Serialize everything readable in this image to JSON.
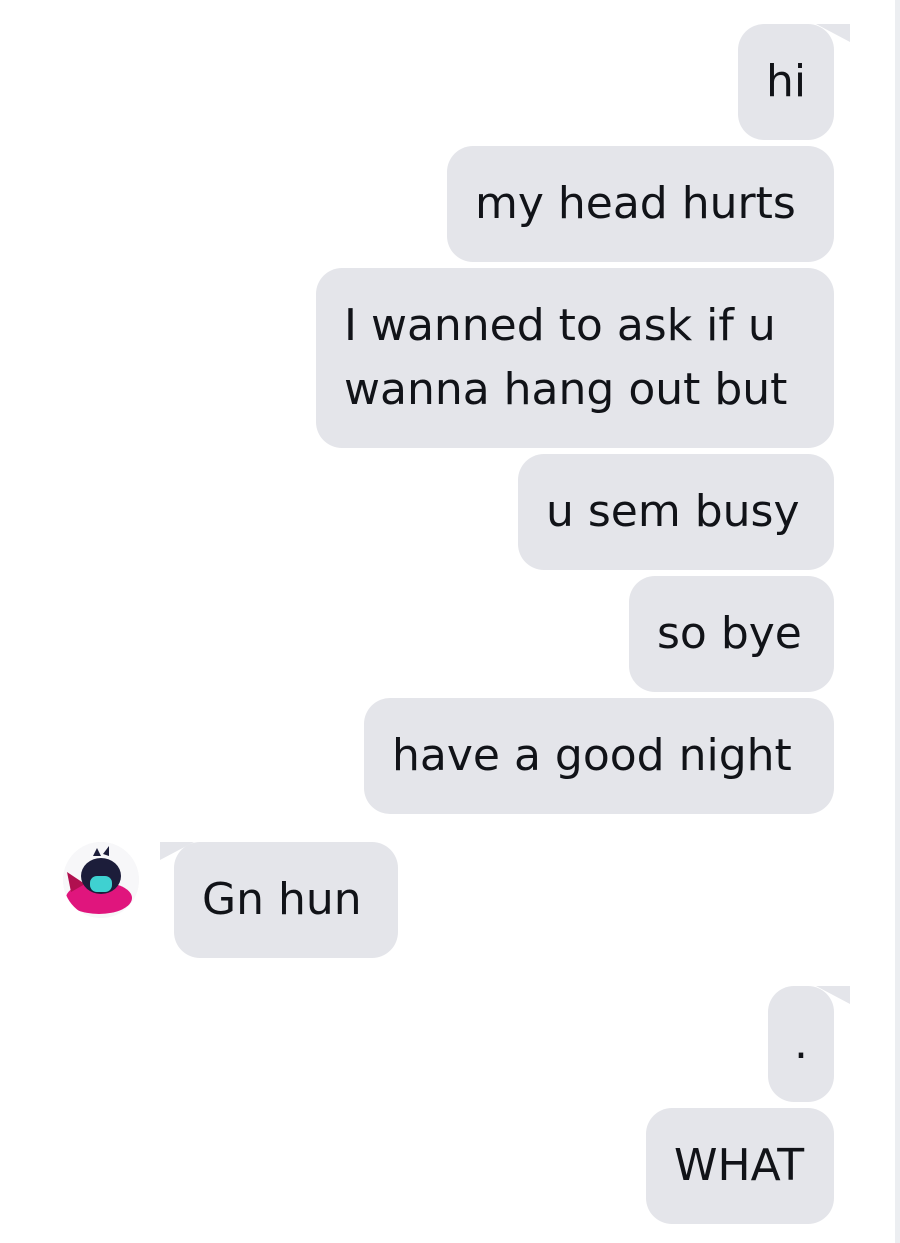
{
  "messages": [
    {
      "id": "hi",
      "side": "outgoing",
      "text": "hi"
    },
    {
      "id": "head",
      "side": "outgoing",
      "text": "my head hurts"
    },
    {
      "id": "ask",
      "side": "outgoing",
      "lines": [
        "I wanned to ask if u",
        "wanna hang out but"
      ]
    },
    {
      "id": "busy",
      "side": "outgoing",
      "text": "u sem busy"
    },
    {
      "id": "bye",
      "side": "outgoing",
      "text": "so bye"
    },
    {
      "id": "night",
      "side": "outgoing",
      "text": "have a good night"
    },
    {
      "id": "gn",
      "side": "incoming",
      "text": "Gn hun",
      "avatar_icon": "user-avatar-icon"
    },
    {
      "id": "dot",
      "side": "outgoing",
      "text": "."
    },
    {
      "id": "what",
      "side": "outgoing",
      "text": "WHAT"
    }
  ],
  "colors": {
    "bubble": "#e4e5ea",
    "text": "#111318",
    "background": "#ffffff",
    "avatar_accent": "#e0157d",
    "avatar_dark": "#1c1d3a",
    "avatar_mask": "#3fd1d1"
  }
}
